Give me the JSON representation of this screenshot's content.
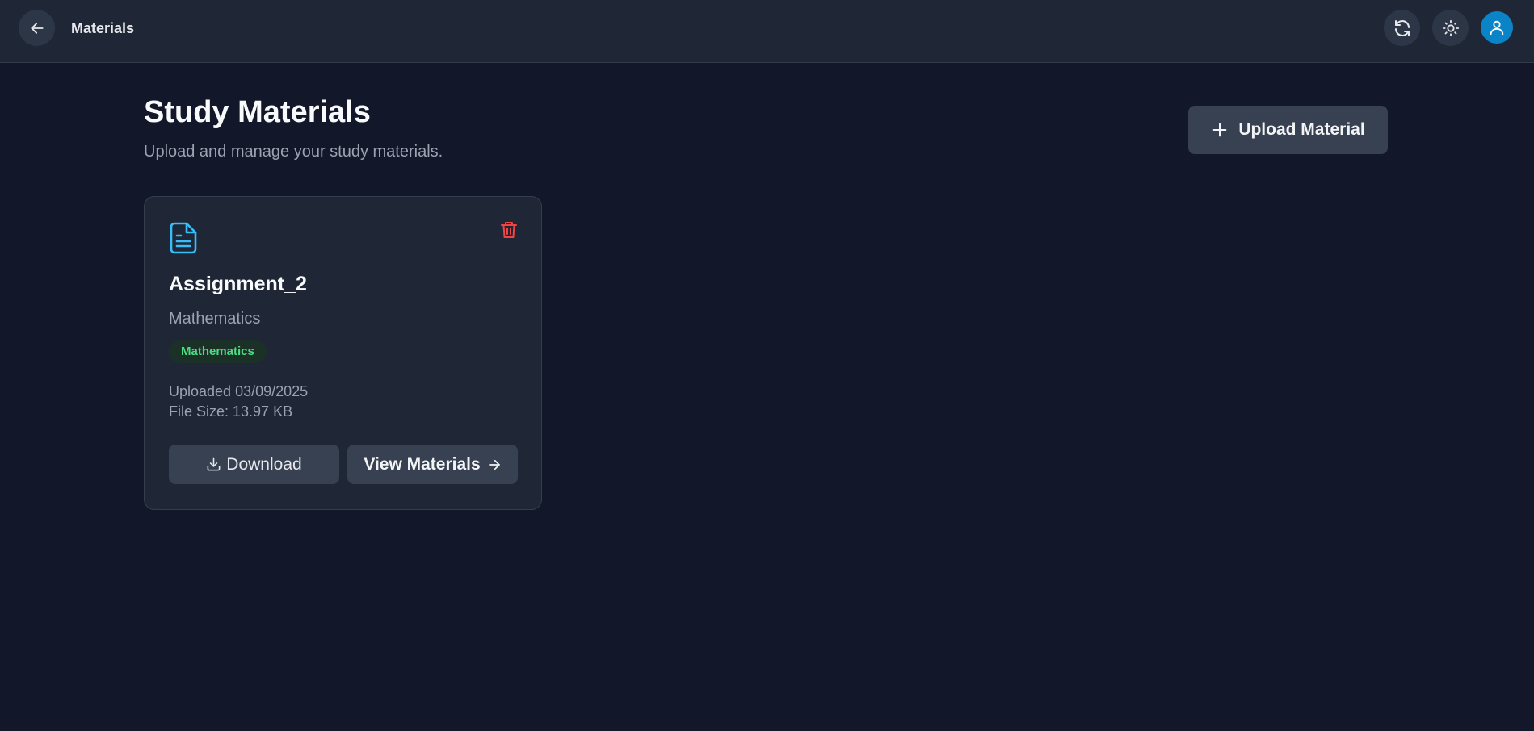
{
  "header": {
    "title": "Materials",
    "back_icon": "arrow-left-icon",
    "refresh_icon": "refresh-icon",
    "theme_icon": "sun-icon",
    "avatar_icon": "user-icon"
  },
  "page": {
    "title": "Study Materials",
    "subtitle": "Upload and manage your study materials."
  },
  "upload_button": {
    "label": "Upload Material",
    "icon": "plus-icon"
  },
  "materials": [
    {
      "title": "Assignment_2",
      "subject": "Mathematics",
      "tag": "Mathematics",
      "uploaded": "Uploaded 03/09/2025",
      "file_size": "File Size: 13.97 KB",
      "download_label": "Download",
      "view_label": "View Materials",
      "icon": "document-icon"
    }
  ],
  "colors": {
    "background": "#121829",
    "surface": "#1f2737",
    "button": "#374151",
    "accent_blue": "#38bdf8",
    "avatar": "#0a84c6",
    "tag_text": "#4ade80",
    "delete": "#ef4444"
  }
}
